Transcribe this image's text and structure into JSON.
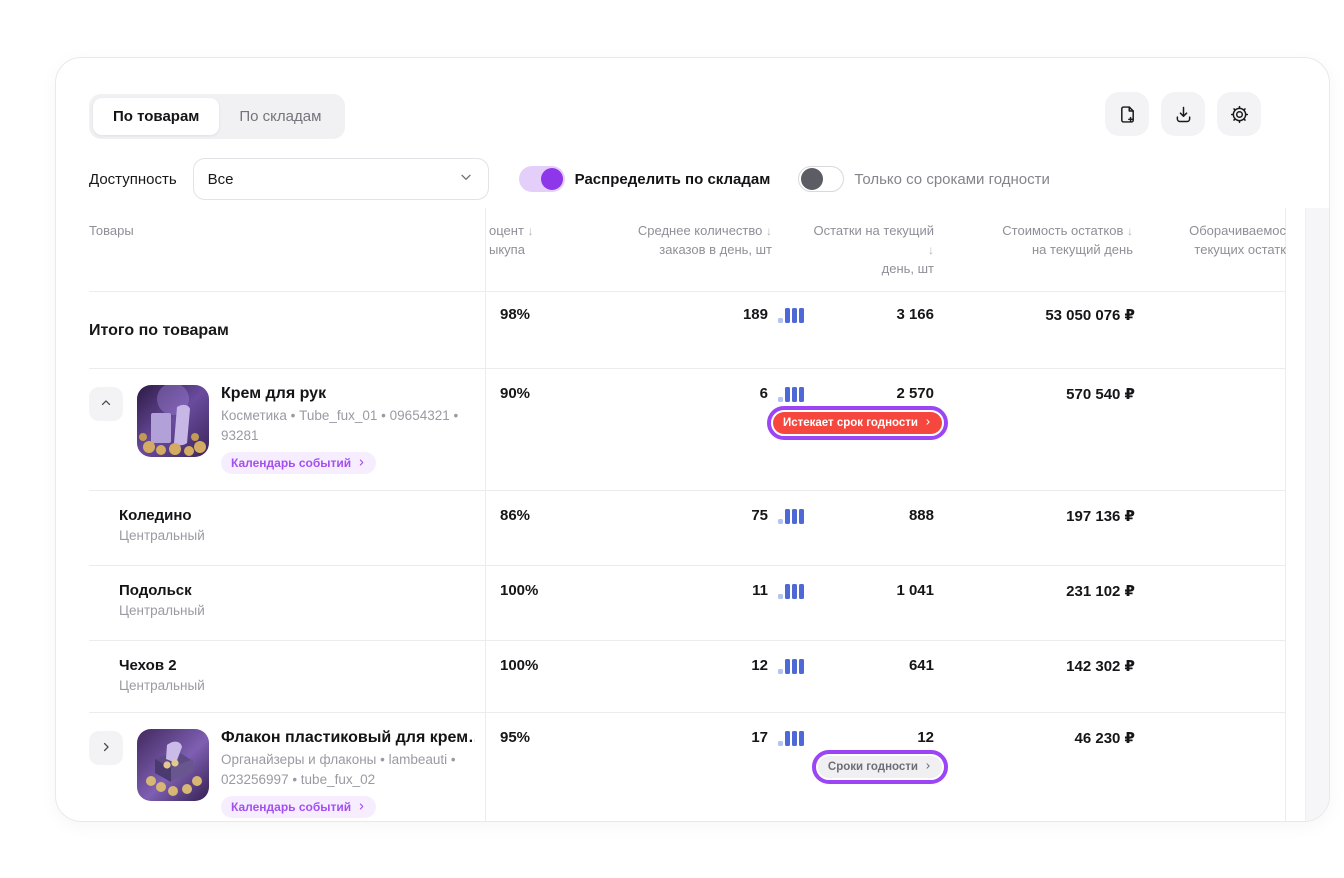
{
  "colors": {
    "accent_purple": "#8e36e9",
    "badge_purple_bg": "#f6eefe",
    "badge_purple_text": "#a44ff2",
    "danger_red": "#f5473d",
    "highlight_ring": "#9b45f5",
    "bar_blue": "#4e68d6",
    "bar_blue_light": "#b3c3f2"
  },
  "icons": {
    "sort_desc": "↓",
    "toolbar": [
      "file-add-icon",
      "download-icon",
      "settings-icon"
    ]
  },
  "tabs": {
    "items": [
      {
        "label": "По товарам",
        "active": true
      },
      {
        "label": "По складам",
        "active": false
      }
    ]
  },
  "filters": {
    "availability": {
      "label": "Доступность",
      "value": "Все"
    },
    "distribute_toggle": {
      "label": "Распределить по складам",
      "on": true
    },
    "expiry_toggle": {
      "label": "Только со сроками годности",
      "on": false
    }
  },
  "table": {
    "columns": {
      "products": {
        "label": "Товары"
      },
      "buyout": {
        "line1": "оцент",
        "line2": "ыкупа",
        "note": "клипнутый заголовок «Процент выкупа»",
        "sort": true
      },
      "avg_orders": {
        "line1": "Среднее количество",
        "line2": "заказов в день, шт",
        "sort": true
      },
      "stock": {
        "line1": "Остатки на текущий",
        "line2": "день, шт",
        "sort": true
      },
      "stock_value": {
        "line1": "Стоимость остатков",
        "line2": "на текущий день",
        "sort": true
      },
      "turnover": {
        "line1": "Оборачиваемос",
        "line2": "текущих остатк",
        "note": "клипнутый заголовок «Оборачиваемость текущих остатков»"
      }
    },
    "rows": [
      {
        "type": "total",
        "title": "Итого по товарам",
        "buyout": "98%",
        "avg_orders": "189",
        "stock": "3 166",
        "stock_value": "53 050 076 ₽"
      },
      {
        "type": "product",
        "expanded": true,
        "title": "Крем для рук",
        "subtitle_line1": "Косметика • Tube_fux_01 • 09654321 •",
        "subtitle_line2": "93281",
        "event_badge": "Календарь событий",
        "buyout": "90%",
        "avg_orders": "6",
        "stock": "2 570",
        "stock_badge": {
          "label": "Истекает срок годности",
          "style": "danger",
          "highlighted": true
        },
        "stock_value": "570 540 ₽"
      },
      {
        "type": "warehouse",
        "title": "Коледино",
        "subtitle": "Центральный",
        "buyout": "86%",
        "avg_orders": "75",
        "stock": "888",
        "stock_value": "197 136 ₽"
      },
      {
        "type": "warehouse",
        "title": "Подольск",
        "subtitle": "Центральный",
        "buyout": "100%",
        "avg_orders": "11",
        "stock": "1 041",
        "stock_value": "231 102 ₽"
      },
      {
        "type": "warehouse",
        "title": "Чехов 2",
        "subtitle": "Центральный",
        "buyout": "100%",
        "avg_orders": "12",
        "stock": "641",
        "stock_value": "142 302 ₽"
      },
      {
        "type": "product",
        "expanded": false,
        "title": "Флакон пластиковый для крем…",
        "subtitle_line1": "Органайзеры и флаконы • lambeauti •",
        "subtitle_line2": "023256997 • tube_fux_02",
        "event_badge": "Календарь событий",
        "buyout": "95%",
        "avg_orders": "17",
        "stock": "12",
        "stock_badge": {
          "label": "Сроки годности",
          "style": "neutral",
          "highlighted": true
        },
        "stock_value": "46 230 ₽"
      }
    ]
  }
}
